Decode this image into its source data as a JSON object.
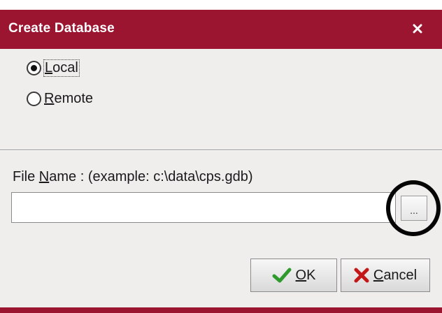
{
  "dialog": {
    "title": "Create Database",
    "close_icon": "close-icon",
    "accent_color": "#9b1530"
  },
  "radio_group": {
    "options": [
      {
        "label_mnemonic": "L",
        "label_rest": "ocal",
        "selected": true
      },
      {
        "label_mnemonic": "R",
        "label_rest": "emote",
        "selected": false
      }
    ]
  },
  "file_name": {
    "label_prefix": "File ",
    "label_mnemonic": "N",
    "label_suffix": "ame :  (example: c:\\data\\cps.gdb)",
    "value": "",
    "browse_label": "...",
    "browse_icon": "ellipsis-icon"
  },
  "buttons": {
    "ok": {
      "mnemonic": "O",
      "rest": "K",
      "icon": "checkmark-icon"
    },
    "cancel": {
      "mnemonic": "C",
      "rest": "ancel",
      "icon": "x-icon"
    }
  }
}
